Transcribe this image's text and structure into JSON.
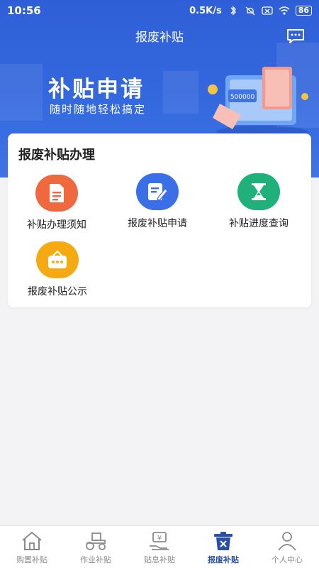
{
  "status_bar": {
    "time": "10:56",
    "network_speed": "0.5K/s",
    "battery": "86"
  },
  "header": {
    "title": "报废补贴"
  },
  "banner": {
    "title": "补贴申请",
    "subtitle": "随时随地轻松搞定",
    "machine_counter": "500000"
  },
  "card": {
    "title": "报废补贴办理",
    "entries": [
      {
        "label": "补贴办理须知",
        "icon": "document-icon",
        "color": "#f0683e"
      },
      {
        "label": "报废补贴申请",
        "icon": "edit-form-icon",
        "color": "#3a6fe8"
      },
      {
        "label": "补贴进度查询",
        "icon": "hourglass-icon",
        "color": "#20b07c"
      },
      {
        "label": "报废补贴公示",
        "icon": "notice-board-icon",
        "color": "#f5aa12"
      }
    ]
  },
  "bottom_nav": {
    "items": [
      {
        "label": "购置补贴",
        "icon": "home-icon"
      },
      {
        "label": "作业补贴",
        "icon": "tractor-icon"
      },
      {
        "label": "贴息补贴",
        "icon": "yen-hand-icon",
        "icon_text": "¥"
      },
      {
        "label": "报废补贴",
        "icon": "scrap-bin-icon",
        "active": true
      },
      {
        "label": "个人中心",
        "icon": "person-icon"
      }
    ]
  },
  "colors": {
    "brand_blue": "#2f5fd8",
    "nav_active": "#2a4fa8",
    "nav_inactive": "#888888"
  }
}
